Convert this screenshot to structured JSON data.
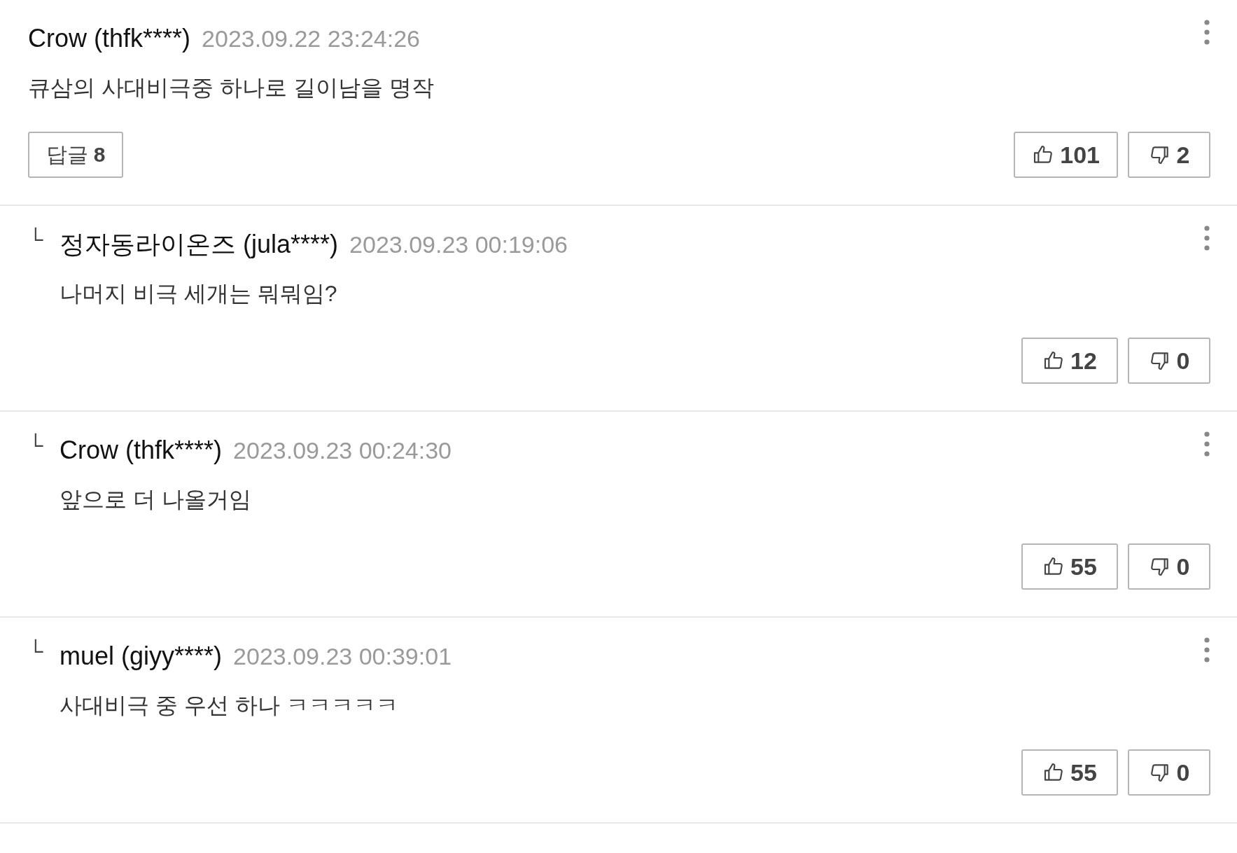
{
  "comments": [
    {
      "kind": "comment",
      "author": "Crow (thfk****)",
      "date": "2023.09.22 23:24:26",
      "text": "큐삼의 사대비극중 하나로 길이남을 명작",
      "reply_label": "답글",
      "reply_count": "8",
      "likes": "101",
      "dislikes": "2"
    },
    {
      "kind": "reply",
      "mark": "└",
      "author": "정자동라이온즈 (jula****)",
      "date": "2023.09.23 00:19:06",
      "text": "나머지 비극 세개는 뭐뭐임?",
      "likes": "12",
      "dislikes": "0"
    },
    {
      "kind": "reply",
      "mark": "└",
      "author": "Crow (thfk****)",
      "date": "2023.09.23 00:24:30",
      "text": "앞으로 더 나올거임",
      "likes": "55",
      "dislikes": "0"
    },
    {
      "kind": "reply",
      "mark": "└",
      "author": "muel (giyy****)",
      "date": "2023.09.23 00:39:01",
      "text": "사대비극 중 우선 하나 ㅋㅋㅋㅋㅋ",
      "likes": "55",
      "dislikes": "0"
    }
  ]
}
